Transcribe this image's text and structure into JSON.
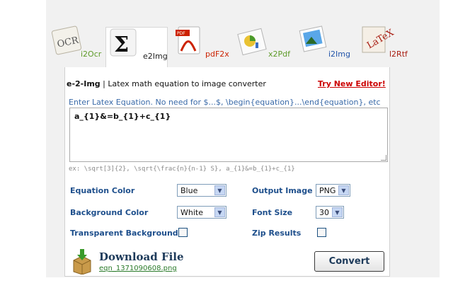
{
  "tabs": [
    {
      "label": "i2Ocr",
      "icon": "ocr-icon"
    },
    {
      "label": "e2Img",
      "icon": "sigma-icon",
      "active": true
    },
    {
      "label": "pdF2x",
      "icon": "pdf-icon"
    },
    {
      "label": "x2Pdf",
      "icon": "chart-doc-icon"
    },
    {
      "label": "i2Img",
      "icon": "image-icon"
    },
    {
      "label": "l2Rtf",
      "icon": "latex-icon"
    }
  ],
  "header": {
    "title_bold": "e-2-Img",
    "title_rest": " | Latex math equation to image converter",
    "try_new_editor": "Try New Editor!"
  },
  "editor": {
    "hint": "Enter Latex Equation. No need for $...$, \\begin{equation}...\\end{equation}, etc",
    "value": "a_{1}&=b_{1}+c_{1}",
    "example": "ex: \\sqrt[3]{2}, \\sqrt{\\frac{n}{n-1} S}, a_{1}&=b_{1}+c_{1}"
  },
  "options": {
    "equation_color_label": "Equation Color",
    "equation_color_value": "Blue",
    "output_image_label": "Output Image",
    "output_image_value": "PNG",
    "background_color_label": "Background Color",
    "background_color_value": "White",
    "font_size_label": "Font Size",
    "font_size_value": "30",
    "transparent_label": "Transparent Background",
    "transparent_checked": false,
    "zip_label": "Zip Results",
    "zip_checked": false
  },
  "download": {
    "title": "Download File",
    "filename": "eqn_1371090608.png"
  },
  "convert_label": "Convert",
  "colors": {
    "label_blue": "#1e4f8c",
    "link_green": "#2a7a2a",
    "try_red": "#cc0000"
  }
}
